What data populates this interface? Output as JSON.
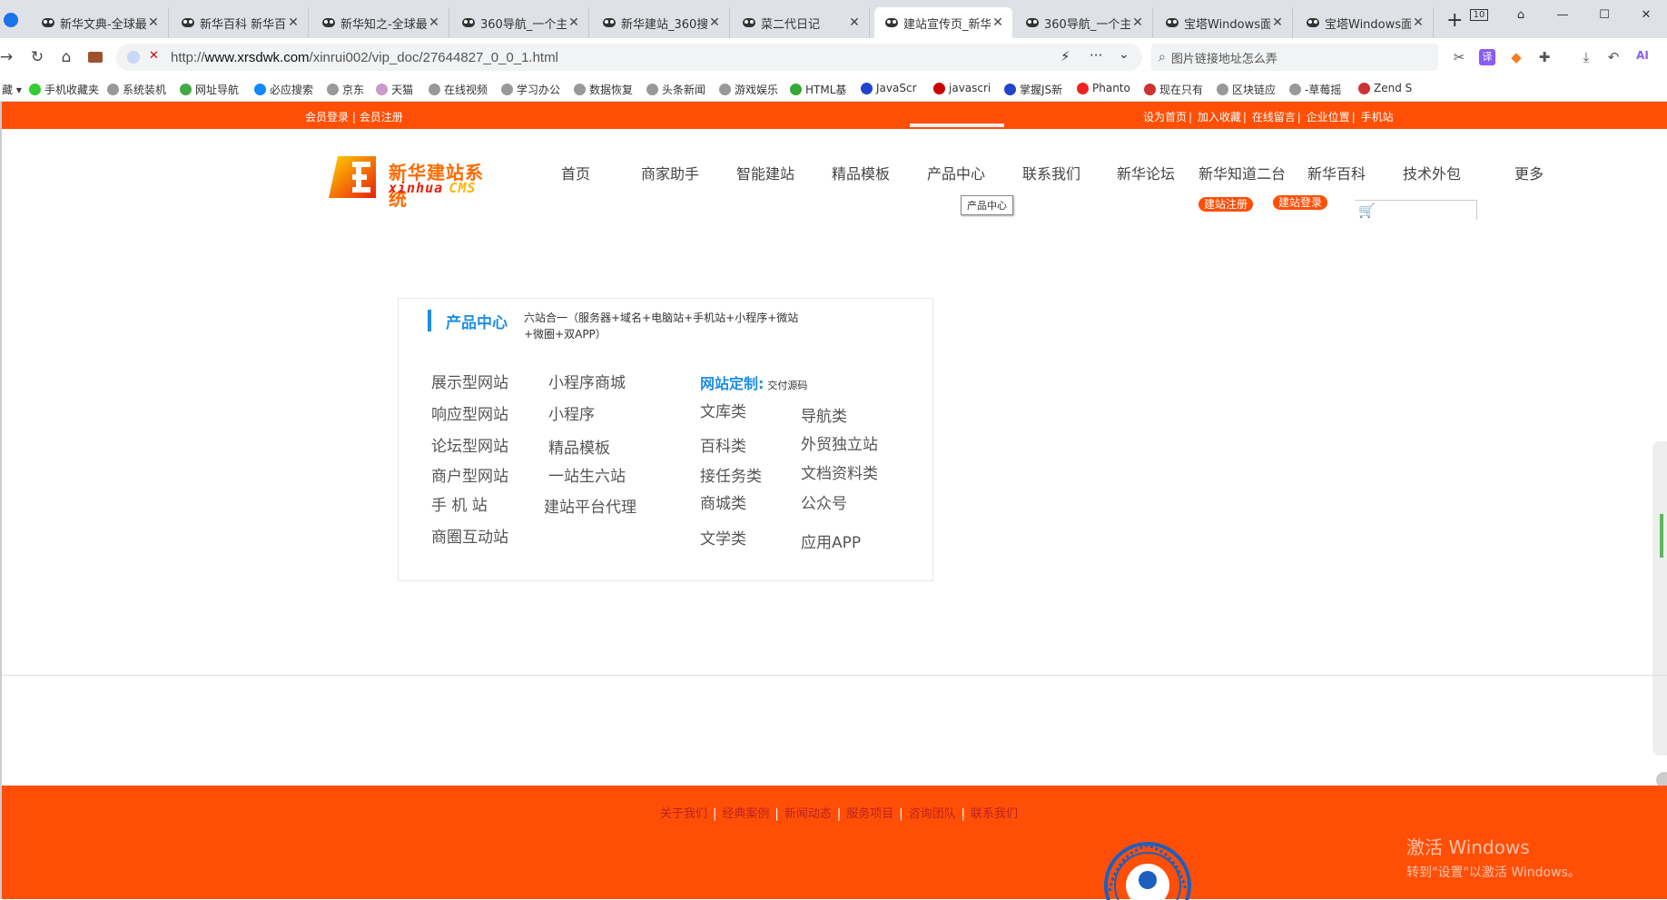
{
  "browser": {
    "tabs": [
      {
        "title": "新华文典-全球最"
      },
      {
        "title": "新华百科 新华百"
      },
      {
        "title": "新华知之-全球最"
      },
      {
        "title": "360导航_一个主"
      },
      {
        "title": "新华建站_360搜"
      },
      {
        "title": "菜二代日记"
      },
      {
        "title": "建站宣传页_新华",
        "active": true
      },
      {
        "title": "360导航_一个主"
      },
      {
        "title": "宝塔Windows面"
      },
      {
        "title": "宝塔Windows面"
      }
    ],
    "tab_count": "10",
    "url_prefix": "http://",
    "url_domain": "www.xrsdwk.com",
    "url_path": "/xinrui002/vip_doc/27644827_0_0_1.html",
    "search_placeholder": "图片链接地址怎么弄",
    "bookmarks": [
      "手机收藏夹",
      "系统装机",
      "网址导航",
      "必应搜索",
      "京东",
      "天猫",
      "在线视频",
      "学习办公",
      "数据恢复",
      "头条新闻",
      "游戏娱乐",
      "HTML基",
      "JavaScr",
      "javascri",
      "掌握JS新",
      "Phanto",
      "现在只有",
      "区块链应",
      "-草莓摇",
      "Zend S"
    ]
  },
  "site": {
    "topbar": {
      "left": [
        "会员登录",
        "会员注册"
      ],
      "right": [
        "设为首页",
        "加入收藏",
        "在线留言",
        "企业位置",
        "手机站"
      ]
    },
    "logo": {
      "cn": "新华建站系统",
      "en": "xinhua",
      "en2": "cms"
    },
    "nav": [
      "首页",
      "商家助手",
      "智能建站",
      "精品模板",
      "产品中心",
      "联系我们",
      "新华论坛",
      "新华知道二台",
      "新华百科",
      "技术外包",
      "更多"
    ],
    "tooltip": "产品中心",
    "pills": [
      "建站注册",
      "建站登录"
    ],
    "panel": {
      "title": "产品中心",
      "desc": "六站合一（服务器+域名+电脑站+手机站+小程序+微站+微圈+双APP）",
      "col1": [
        "展示型网站",
        "响应型网站",
        "论坛型网站",
        "商户型网站",
        "手 机 站",
        "商圈互动站"
      ],
      "col2": [
        "小程序商城",
        "小程序",
        "精品模板",
        "一站生六站",
        "建站平台代理"
      ],
      "custom_label": "网站定制:",
      "custom_note": "交付源码",
      "col3": [
        "文库类",
        "百科类",
        "接任务类",
        "商城类",
        "文学类"
      ],
      "col4": [
        "导航类",
        "外贸独立站",
        "文档资料类",
        "公众号",
        "应用APP"
      ]
    },
    "footer": {
      "links": [
        "关于我们",
        "经典案例",
        "新闻动态",
        "服务项目",
        "咨询团队",
        "联系我们"
      ],
      "activate_title": "激活 Windows",
      "activate_sub": "转到\"设置\"以激活 Windows。"
    }
  }
}
